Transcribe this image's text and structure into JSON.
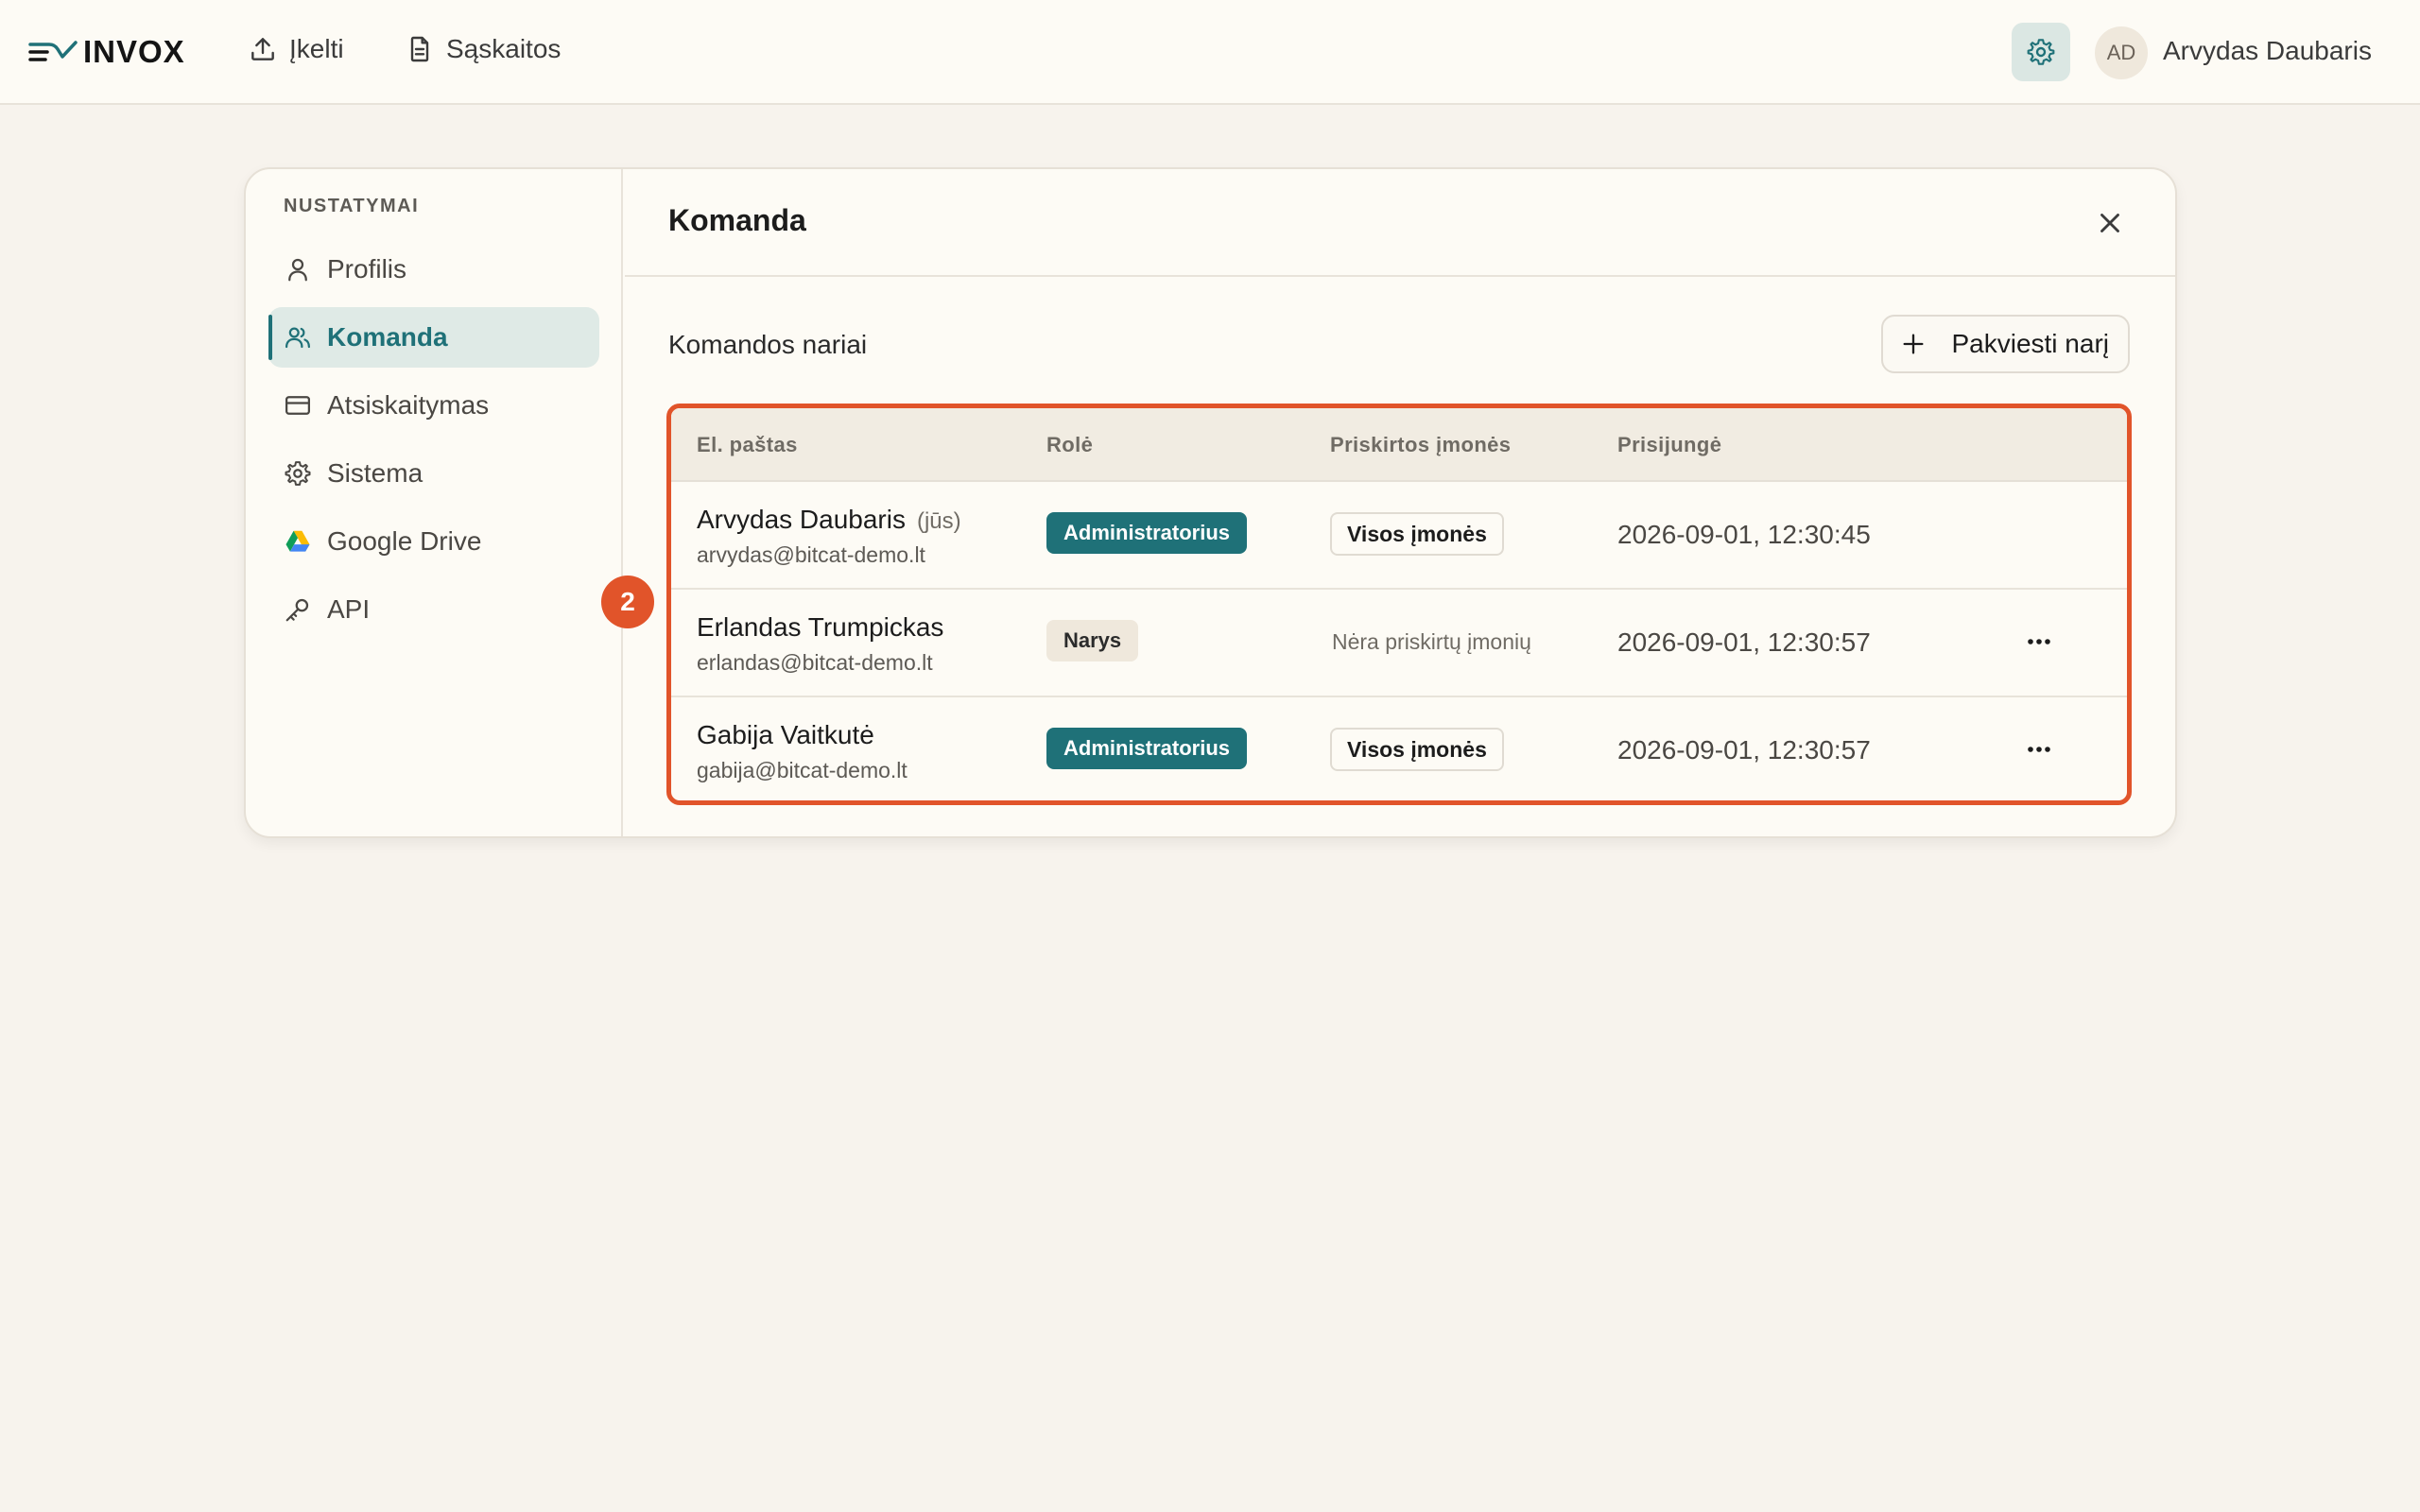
{
  "topbar": {
    "logo_text": "INVOX",
    "nav": [
      {
        "label": "Įkelti",
        "icon": "upload-icon"
      },
      {
        "label": "Sąskaitos",
        "icon": "document-icon"
      }
    ],
    "settings_icon": "gear-icon",
    "user_initials": "AD",
    "user_name": "Arvydas Daubaris"
  },
  "sidebar": {
    "heading": "NUSTATYMAI",
    "items": [
      {
        "label": "Profilis",
        "icon": "user-icon"
      },
      {
        "label": "Komanda",
        "icon": "users-icon",
        "active": true
      },
      {
        "label": "Atsiskaitymas",
        "icon": "credit-card-icon"
      },
      {
        "label": "Sistema",
        "icon": "gear-icon"
      },
      {
        "label": "Google Drive",
        "icon": "google-drive-icon"
      },
      {
        "label": "API",
        "icon": "key-icon"
      }
    ]
  },
  "main": {
    "title": "Komanda",
    "section_title": "Komandos nariai",
    "invite_label": "Pakviesti narį",
    "table": {
      "headers": [
        "El. paštas",
        "Rolė",
        "Priskirtos įmonės",
        "Prisijungė"
      ],
      "rows": [
        {
          "name": "Arvydas Daubaris",
          "you": "(jūs)",
          "email": "arvydas@bitcat-demo.lt",
          "role": "Administratorius",
          "companies": "Visos įmonės",
          "joined": "2026-09-01, 12:30:45"
        },
        {
          "name": "Erlandas Trumpickas",
          "email": "erlandas@bitcat-demo.lt",
          "role": "Narys",
          "companies": "Nėra priskirtų įmonių",
          "joined": "2026-09-01, 12:30:57"
        },
        {
          "name": "Gabija Vaitkutė",
          "email": "gabija@bitcat-demo.lt",
          "role": "Administratorius",
          "companies": "Visos įmonės",
          "joined": "2026-09-01, 12:30:57"
        }
      ]
    }
  },
  "annotation": {
    "step": "2"
  },
  "colors": {
    "accent": "#1f7178",
    "highlight": "#e1542a",
    "background": "#f7f3ed"
  }
}
